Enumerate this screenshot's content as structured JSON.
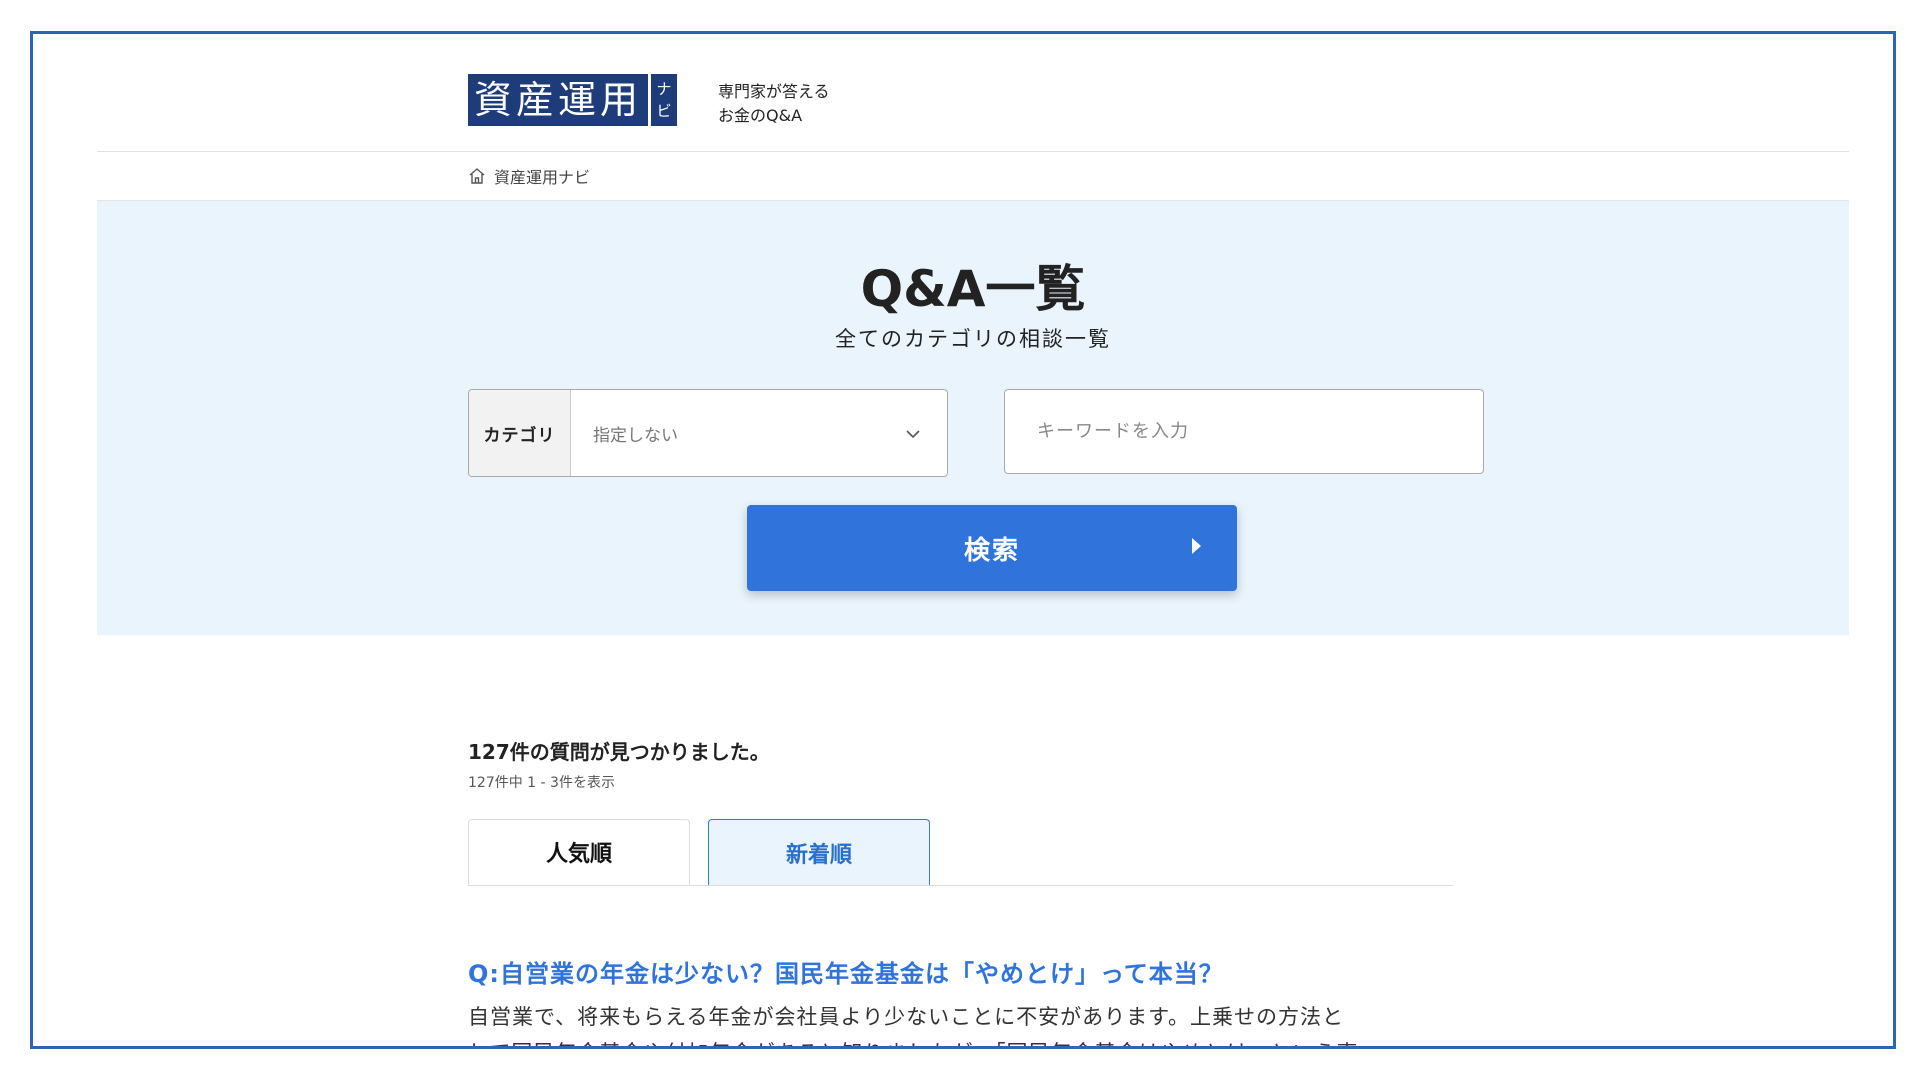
{
  "header": {
    "logo_main": "資産運用",
    "logo_side_1": "ナ",
    "logo_side_2": "ビ",
    "tagline_line1": "専門家が答える",
    "tagline_line2": "お金のQ&A"
  },
  "breadcrumb": {
    "home_label": "資産運用ナビ"
  },
  "hero": {
    "title": "Q&A一覧",
    "subtitle": "全てのカテゴリの相談一覧",
    "category_label": "カテゴリ",
    "category_value": "指定しない",
    "keyword_placeholder": "キーワードを入力",
    "search_label": "検索"
  },
  "results": {
    "count_text": "127件の質問が見つかりました。",
    "range_text": "127件中 1 - 3件を表示"
  },
  "tabs": {
    "popular": "人気順",
    "newest": "新着順"
  },
  "question": {
    "title": "Q:自営業の年金は少ない？国民年金基金は「やめとけ」って本当？",
    "body_line1": "自営業で、将来もらえる年金が会社員より少ないことに不安があります。上乗せの方法と",
    "body_line2": "して国民年金基金や付加年金があると知りましたが、「国民年金基金はやめとけ」という声"
  },
  "colors": {
    "frame_border": "#2a66b3",
    "logo_bg": "#1f3c7a",
    "hero_bg": "#eaf4fd",
    "primary": "#2f73db"
  }
}
